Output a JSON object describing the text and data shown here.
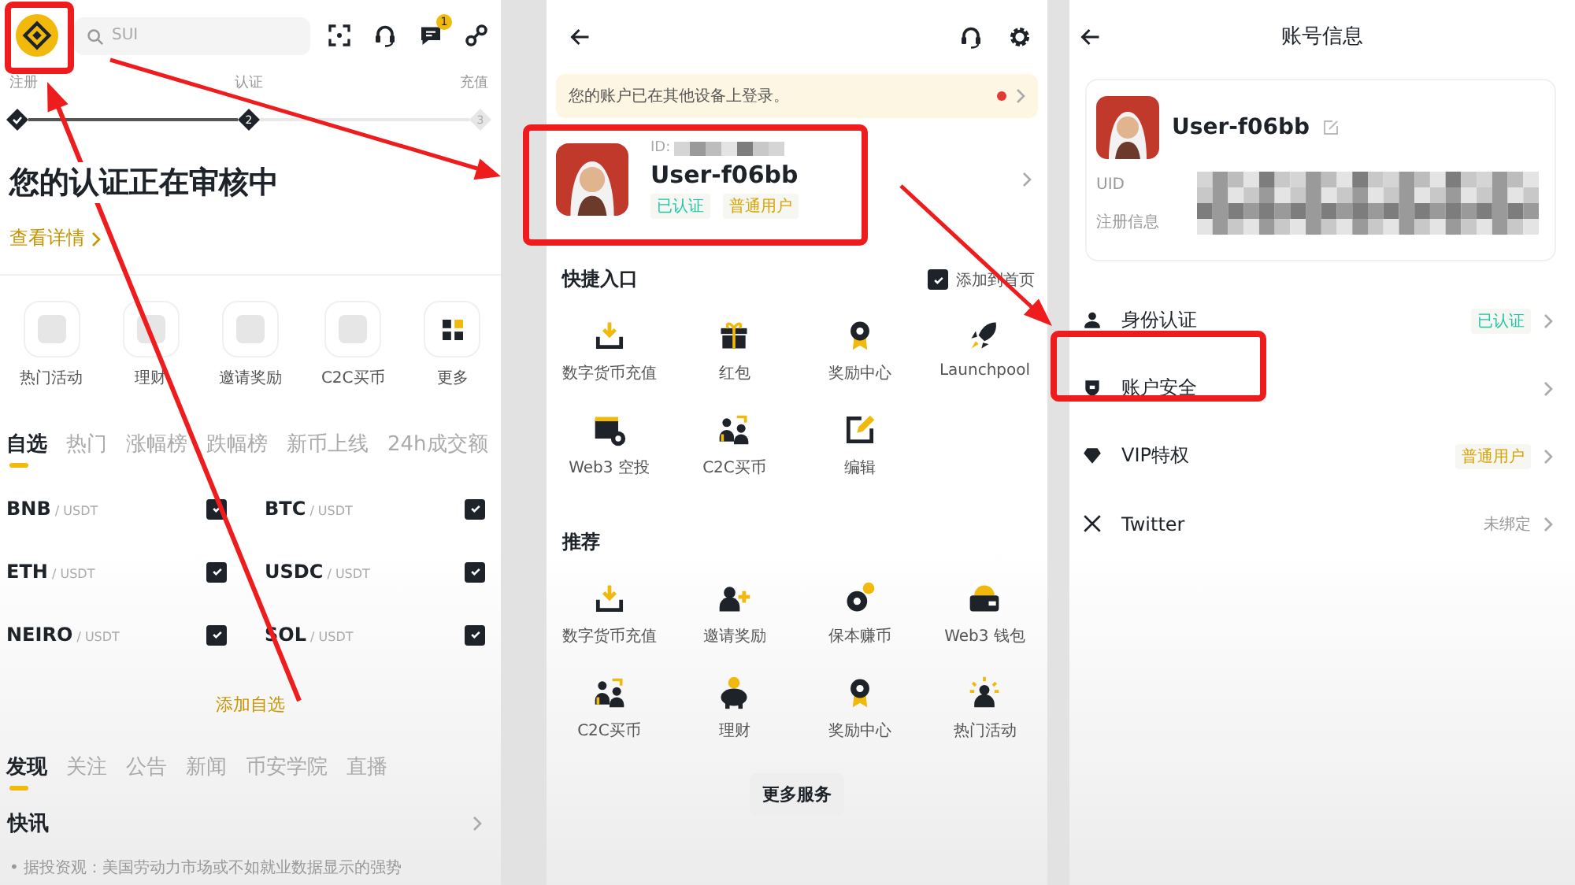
{
  "home": {
    "search": {
      "placeholder": "SUI"
    },
    "notification_count": "1",
    "steps": [
      {
        "label": "注册",
        "done": true
      },
      {
        "label": "认证",
        "done": true,
        "number": "2"
      },
      {
        "label": "充值",
        "done": false,
        "number": "3"
      }
    ],
    "heading": "您的认证正在审核中",
    "details_link": "查看详情",
    "shortcuts": [
      {
        "label": "热门活动",
        "kind": "placeholder"
      },
      {
        "label": "理财",
        "kind": "placeholder"
      },
      {
        "label": "邀请奖励",
        "kind": "placeholder"
      },
      {
        "label": "C2C买币",
        "kind": "placeholder"
      },
      {
        "label": "更多",
        "kind": "more"
      }
    ],
    "market_tabs": [
      {
        "label": "自选",
        "selected": true
      },
      {
        "label": "热门",
        "selected": false
      },
      {
        "label": "涨幅榜",
        "selected": false
      },
      {
        "label": "跌幅榜",
        "selected": false
      },
      {
        "label": "新币上线",
        "selected": false
      },
      {
        "label": "24h成交额",
        "selected": false
      }
    ],
    "watchlist": [
      {
        "base": "BNB",
        "quote": "/ USDT",
        "checked": true
      },
      {
        "base": "BTC",
        "quote": "/ USDT",
        "checked": true
      },
      {
        "base": "ETH",
        "quote": "/ USDT",
        "checked": true
      },
      {
        "base": "USDC",
        "quote": "/ USDT",
        "checked": true
      },
      {
        "base": "NEIRO",
        "quote": "/ USDT",
        "checked": true
      },
      {
        "base": "SOL",
        "quote": "/ USDT",
        "checked": true
      }
    ],
    "add_button": "添加自选",
    "feed_tabs": [
      {
        "label": "发现",
        "selected": true
      },
      {
        "label": "关注",
        "selected": false
      },
      {
        "label": "公告",
        "selected": false
      },
      {
        "label": "新闻",
        "selected": false
      },
      {
        "label": "币安学院",
        "selected": false
      },
      {
        "label": "直播",
        "selected": false
      }
    ],
    "flash_title": "快讯",
    "news": "• 据投资观：美国劳动力市场或不如就业数据显示的强势"
  },
  "account_menu": {
    "banner": "您的账户已在其他设备上登录。",
    "profile": {
      "id_label": "ID:",
      "name": "User-f06bb",
      "tags": [
        {
          "label": "已认证",
          "color": "#1fc7a6"
        },
        {
          "label": "普通用户",
          "color": "#d9a400"
        }
      ]
    },
    "quick_title": "快捷入口",
    "add_to_home": {
      "label": "添加到首页",
      "checked": true
    },
    "quick_items": [
      {
        "label": "数字货币充值",
        "kind": "deposit"
      },
      {
        "label": "红包",
        "kind": "gift"
      },
      {
        "label": "奖励中心",
        "kind": "medal"
      },
      {
        "label": "Launchpool",
        "kind": "rocket"
      },
      {
        "label": "Web3 空投",
        "kind": "airdrop"
      },
      {
        "label": "C2C买币",
        "kind": "c2c"
      },
      {
        "label": "编辑",
        "kind": "edit"
      }
    ],
    "recommend_title": "推荐",
    "recommend_items": [
      {
        "label": "数字货币充值",
        "kind": "deposit"
      },
      {
        "label": "邀请奖励",
        "kind": "invite"
      },
      {
        "label": "保本赚币",
        "kind": "earn"
      },
      {
        "label": "Web3 钱包",
        "kind": "wallet"
      },
      {
        "label": "C2C买币",
        "kind": "c2c"
      },
      {
        "label": "理财",
        "kind": "piggy"
      },
      {
        "label": "奖励中心",
        "kind": "medal"
      },
      {
        "label": "热门活动",
        "kind": "event"
      }
    ],
    "more_button": "更多服务"
  },
  "account_info": {
    "title": "账号信息",
    "name": "User-f06bb",
    "fields": [
      "UID",
      "注册信息"
    ],
    "rows": [
      {
        "label": "身份认证",
        "kind": "person",
        "value": "已认证",
        "color": "#1fc7a6"
      },
      {
        "label": "账户安全",
        "kind": "shield"
      },
      {
        "label": "VIP特权",
        "kind": "vip",
        "value": "普通用户",
        "color": "#d9a400"
      },
      {
        "label": "Twitter",
        "kind": "x",
        "value": "未绑定"
      }
    ]
  }
}
